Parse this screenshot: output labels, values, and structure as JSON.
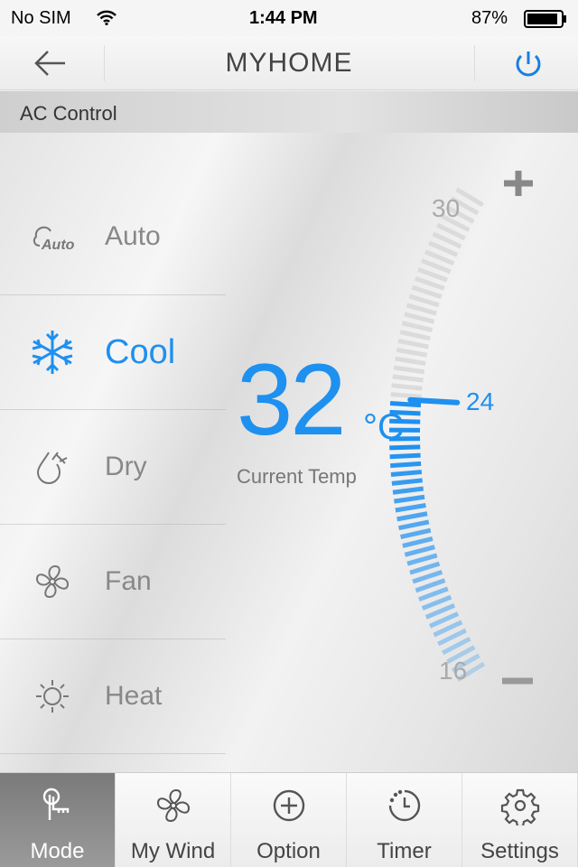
{
  "status": {
    "carrier": "No SIM",
    "time": "1:44 PM",
    "battery": "87%",
    "battery_level": 0.87
  },
  "nav": {
    "title": "MYHOME",
    "back_icon": "arrow-left-icon",
    "power_icon": "power-icon"
  },
  "section": {
    "title": "AC Control"
  },
  "modes": [
    {
      "label": "Auto",
      "icon": "auto-icon",
      "active": false
    },
    {
      "label": "Cool",
      "icon": "snowflake-icon",
      "active": true
    },
    {
      "label": "Dry",
      "icon": "droplet-icon",
      "active": false
    },
    {
      "label": "Fan",
      "icon": "fan-icon",
      "active": false
    },
    {
      "label": "Heat",
      "icon": "sun-icon",
      "active": false
    }
  ],
  "current": {
    "value": "32",
    "unit": "°C",
    "caption": "Current Temp"
  },
  "setpoint": {
    "value": 24,
    "label": "24",
    "min": 16,
    "max": 30,
    "min_label": "16",
    "max_label": "30",
    "accent": "#1e90f0"
  },
  "tabs": [
    {
      "label": "Mode",
      "icon": "touch-icon",
      "active": true
    },
    {
      "label": "My Wind",
      "icon": "fan-icon",
      "active": false
    },
    {
      "label": "Option",
      "icon": "plus-circle-icon",
      "active": false
    },
    {
      "label": "Timer",
      "icon": "timer-icon",
      "active": false
    },
    {
      "label": "Settings",
      "icon": "gear-icon",
      "active": false
    }
  ]
}
